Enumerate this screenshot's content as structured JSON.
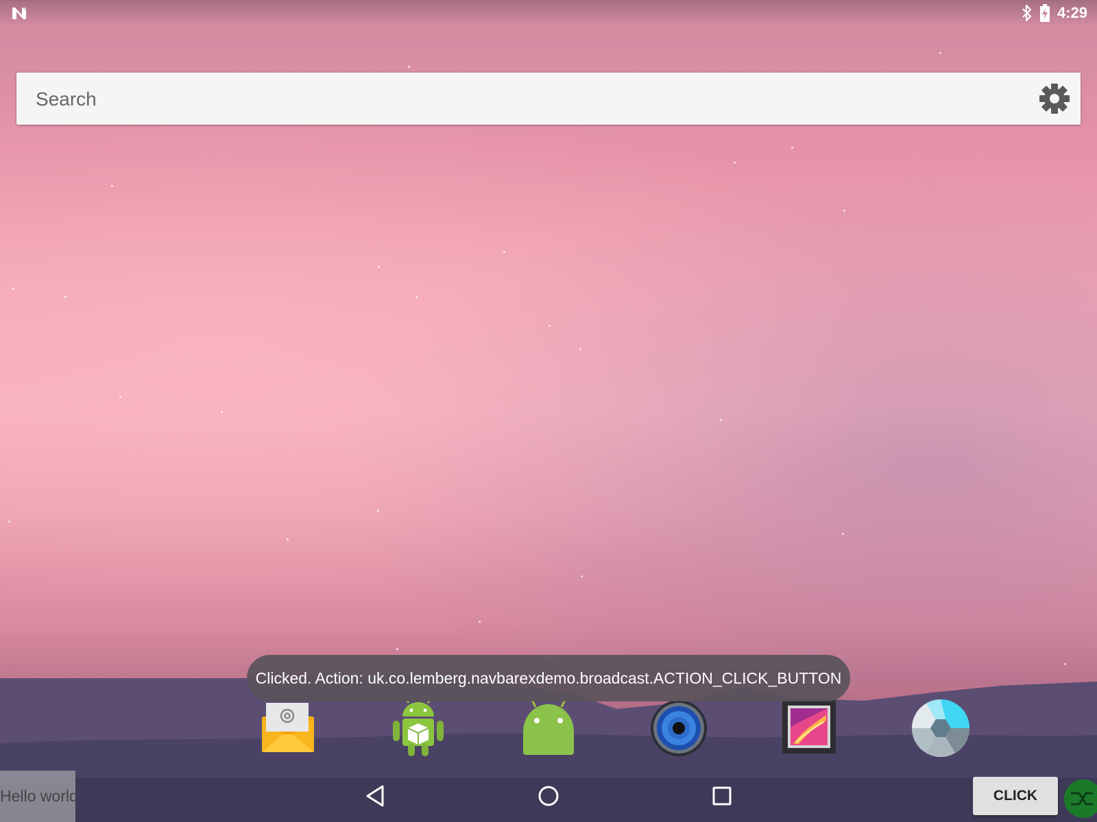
{
  "status_bar": {
    "clock": "4:29",
    "left_icon": "n-notification-icon",
    "icons": [
      "bluetooth-icon",
      "battery-charging-icon"
    ]
  },
  "search": {
    "placeholder": "Search",
    "settings_icon": "gear-icon"
  },
  "toast": {
    "message": "Clicked. Action: uk.co.lemberg.navbarexdemo.broadcast.ACTION_CLICK_BUTTON"
  },
  "dock": {
    "apps": [
      {
        "icon": "email-icon"
      },
      {
        "icon": "android-robot-box-icon"
      },
      {
        "icon": "android-icon"
      },
      {
        "icon": "speaker-icon"
      },
      {
        "icon": "gallery-icon"
      },
      {
        "icon": "camera-aperture-icon"
      }
    ]
  },
  "nav_bar": {
    "hello_text": "Hello world",
    "click_label": "CLICK",
    "buttons": [
      "back-icon",
      "home-icon",
      "recents-icon"
    ]
  },
  "colors": {
    "search_bg": "#f5f5f5",
    "toast_bg": "#5a525a",
    "fab": "#1b7a2a",
    "nav_icon": "#ffffff"
  }
}
